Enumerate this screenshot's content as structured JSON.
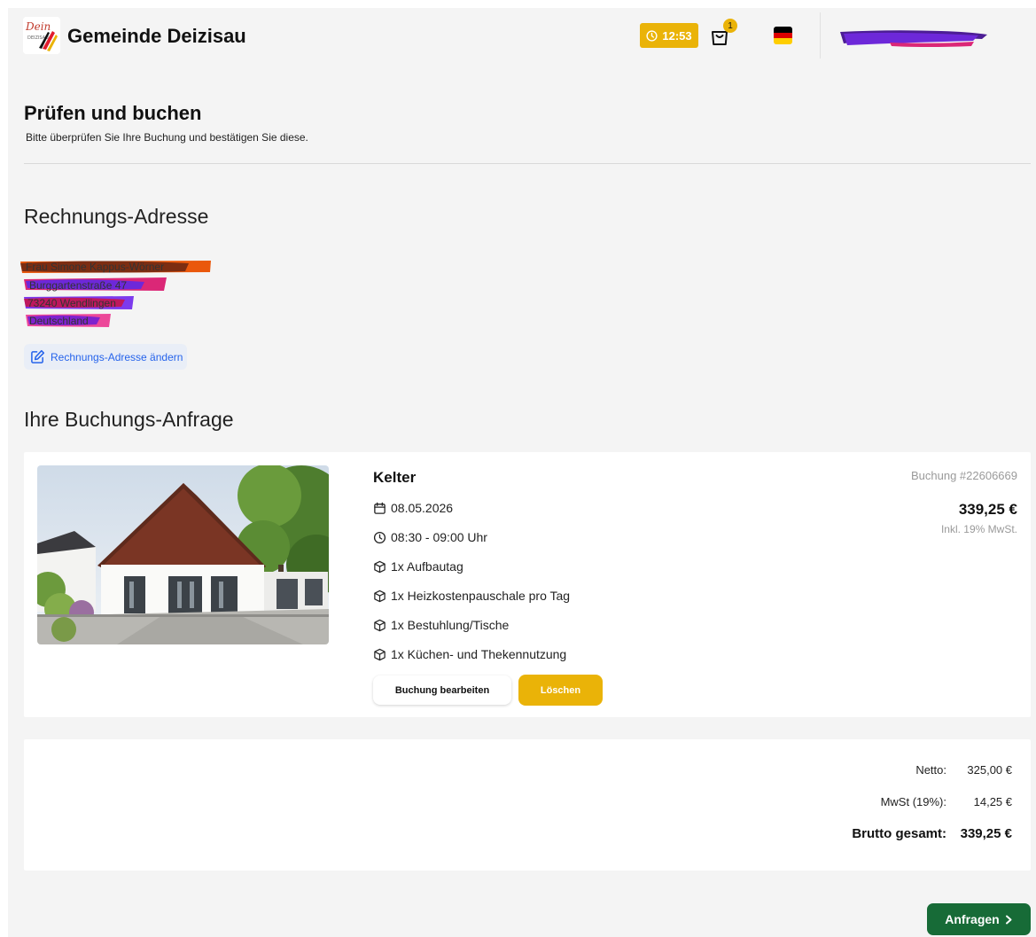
{
  "header": {
    "logo_text": "Dein DEIZISAU",
    "brand": "Gemeinde Deizisau",
    "timer": "12:53",
    "cart_count": "1",
    "language_flag": "de-flag-icon"
  },
  "main": {
    "title": "Prüfen und buchen",
    "subtitle": "Bitte überprüfen Sie Ihre Buchung und bestätigen Sie diese."
  },
  "billing": {
    "title": "Rechnungs-Adresse",
    "lines": [
      "Frau Simone Kappus-Wörner",
      "Burggartenstraße 47",
      "73240 Wendlingen",
      "Deutschland"
    ],
    "change_label": "Rechnungs-Adresse ändern"
  },
  "booking": {
    "title": "Ihre Buchungs-Anfrage",
    "venue": "Kelter",
    "date": "08.05.2026",
    "time": "08:30 - 09:00 Uhr",
    "items": [
      "1x Aufbautag",
      "1x Heizkostenpauschale pro Tag",
      "1x Bestuhlung/Tische",
      "1x Küchen- und Thekennutzung"
    ],
    "number": "Buchung #22606669",
    "price": "339,25 €",
    "vat_note": "Inkl. 19% MwSt.",
    "edit_label": "Buchung bearbeiten",
    "delete_label": "Löschen"
  },
  "totals": {
    "net_label": "Netto:",
    "net_value": "325,00 €",
    "vat_label": "MwSt (19%):",
    "vat_value": "14,25 €",
    "gross_label": "Brutto gesamt:",
    "gross_value": "339,25 €"
  },
  "actions": {
    "submit_label": "Anfragen"
  },
  "colors": {
    "accent": "#eab308",
    "primary": "#176b37",
    "link": "#2563eb",
    "background": "#f4f4f4"
  }
}
